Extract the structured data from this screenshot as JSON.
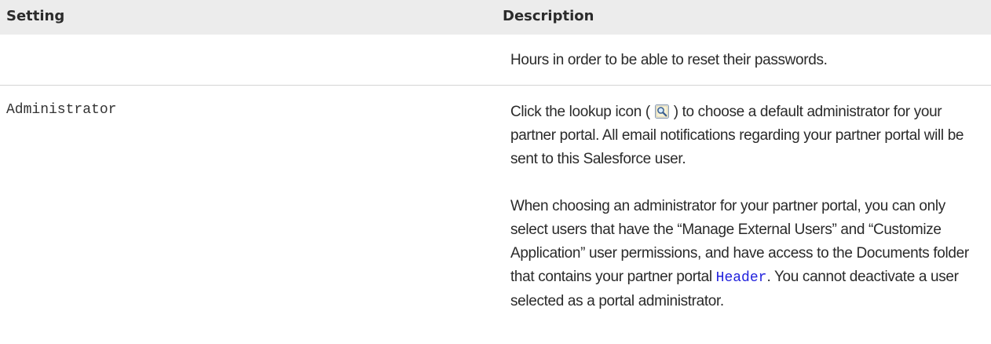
{
  "table": {
    "headers": {
      "setting": "Setting",
      "description": "Description"
    },
    "row1": {
      "description": "Hours in order to be able to reset their passwords."
    },
    "row2": {
      "setting": "Administrator",
      "para1_before_icon": "Click the lookup icon (",
      "para1_after_icon": ") to choose a default administrator for your partner portal. All email notifications regarding your partner portal will be sent to this Salesforce user.",
      "para2_before_link": "When choosing an administrator for your partner portal, you can only select users that have the “Manage External Users” and “Customize Application” user permissions, and have access to the Documents folder that contains your partner portal ",
      "para2_link": "Header",
      "para2_after_link": ". You cannot deactivate a user selected as a portal administrator."
    }
  },
  "icons": {
    "lookup": "lookup-icon"
  },
  "colors": {
    "header_bg": "#ececec",
    "link": "#2222dd",
    "divider": "#d4d4d4"
  }
}
